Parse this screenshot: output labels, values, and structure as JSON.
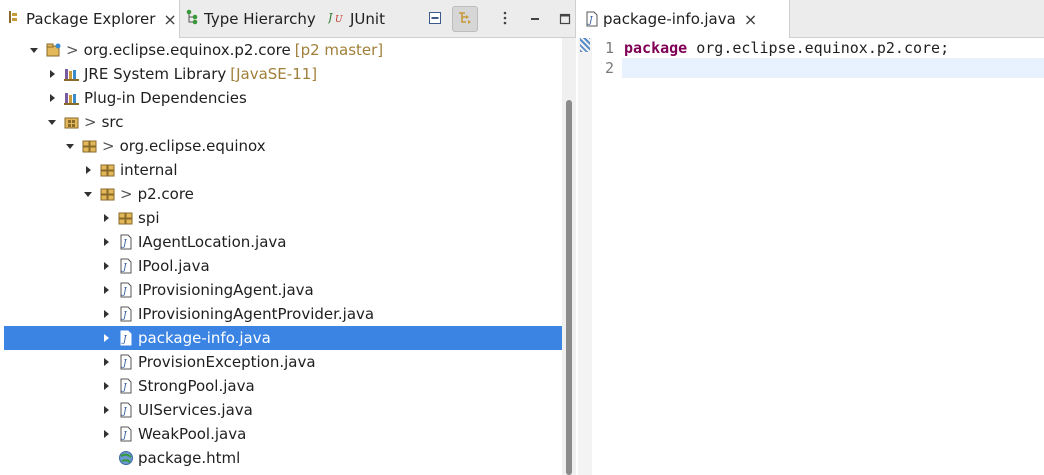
{
  "explorer": {
    "tabs": [
      {
        "label": "Package Explorer",
        "icon": "package-explorer-icon",
        "active": true,
        "closable": true
      },
      {
        "label": "Type Hierarchy",
        "icon": "type-hierarchy-icon",
        "active": false
      },
      {
        "label": "JUnit",
        "icon": "junit-icon",
        "active": false
      }
    ],
    "toolbar": {
      "collapse_all": "collapse-all-icon",
      "link_with_editor": "link-with-editor-icon",
      "view_menu": "view-menu-icon",
      "minimize": "minimize-icon",
      "maximize": "maximize-icon"
    },
    "tree": [
      {
        "label": "org.eclipse.equinox.p2.core",
        "decoration": "[p2 master]",
        "git": ">",
        "icon": "project-icon",
        "indent": 0,
        "expanded": true
      },
      {
        "label": "JRE System Library",
        "decoration": "[JavaSE-11]",
        "icon": "library-icon",
        "indent": 1,
        "expanded": false
      },
      {
        "label": "Plug-in Dependencies",
        "icon": "library-icon",
        "indent": 1,
        "expanded": false
      },
      {
        "label": "src",
        "git": ">",
        "icon": "source-folder-icon",
        "indent": 1,
        "expanded": true
      },
      {
        "label": "org.eclipse.equinox",
        "git": ">",
        "icon": "package-icon",
        "indent": 2,
        "expanded": true
      },
      {
        "label": "internal",
        "icon": "package-icon",
        "indent": 3,
        "expanded": false
      },
      {
        "label": "p2.core",
        "git": ">",
        "icon": "package-icon",
        "indent": 3,
        "expanded": true
      },
      {
        "label": "spi",
        "icon": "package-icon",
        "indent": 4,
        "expanded": false
      },
      {
        "label": "IAgentLocation.java",
        "icon": "java-file-icon",
        "indent": 4,
        "expanded": false
      },
      {
        "label": "IPool.java",
        "icon": "java-file-icon",
        "indent": 4,
        "expanded": false
      },
      {
        "label": "IProvisioningAgent.java",
        "icon": "java-file-icon",
        "indent": 4,
        "expanded": false
      },
      {
        "label": "IProvisioningAgentProvider.java",
        "icon": "java-file-icon",
        "indent": 4,
        "expanded": false
      },
      {
        "label": "package-info.java",
        "icon": "java-file-icon",
        "indent": 4,
        "expanded": false,
        "selected": true
      },
      {
        "label": "ProvisionException.java",
        "icon": "java-file-icon",
        "indent": 4,
        "expanded": false
      },
      {
        "label": "StrongPool.java",
        "icon": "java-file-icon",
        "indent": 4,
        "expanded": false
      },
      {
        "label": "UIServices.java",
        "icon": "java-file-icon",
        "indent": 4,
        "expanded": false
      },
      {
        "label": "WeakPool.java",
        "icon": "java-file-icon",
        "indent": 4,
        "expanded": false
      },
      {
        "label": "package.html",
        "icon": "html-file-icon",
        "indent": 4,
        "leaf": true
      }
    ]
  },
  "editor": {
    "tab": {
      "label": "package-info.java",
      "icon": "java-file-icon"
    },
    "lines": [
      {
        "number": "1",
        "keyword": "package",
        "text": " org.eclipse.equinox.p2.core;"
      },
      {
        "number": "2",
        "keyword": "",
        "text": "",
        "current": true
      }
    ]
  },
  "colors": {
    "selection": "#3b84e3",
    "keyword": "#7f0055",
    "decoration": "#a0803a",
    "current_line": "#e8f2fe"
  }
}
